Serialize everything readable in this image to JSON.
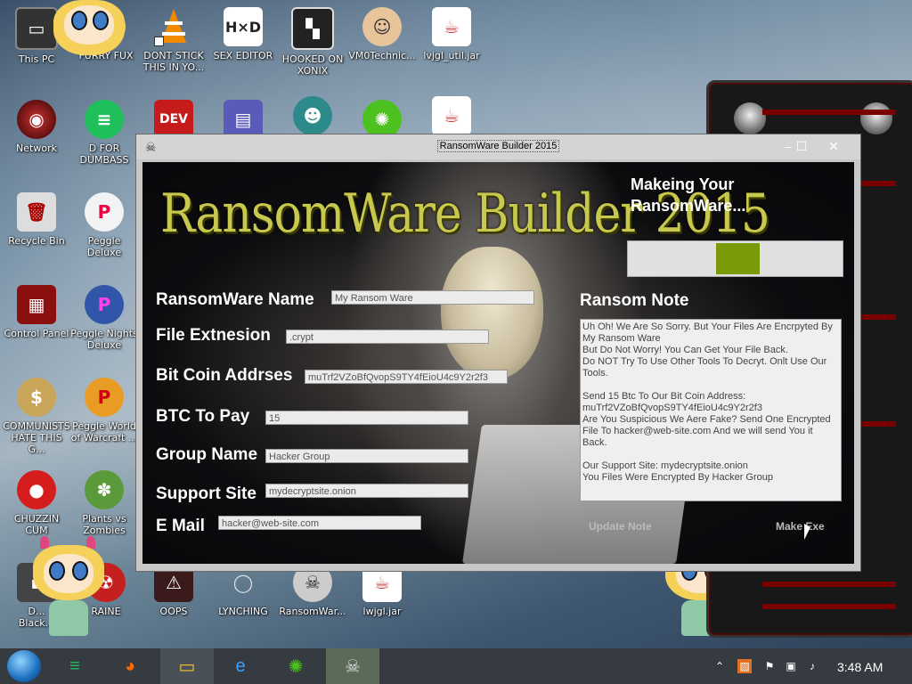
{
  "desktop": {
    "icons": [
      {
        "label": "This PC",
        "icon": "this-pc-icon"
      },
      {
        "label": "FURRY FUX",
        "icon": "furry-fux-icon"
      },
      {
        "label": "DONT STICK THIS IN YO...",
        "icon": "vlc-cone-icon"
      },
      {
        "label": "SEX EDITOR",
        "icon": "hxd-editor-icon"
      },
      {
        "label": "HOOKED ON XONIX",
        "icon": "xonix-game-icon"
      },
      {
        "label": "VM0Technic...",
        "icon": "doctor-icon"
      },
      {
        "label": "lvjgl_util.jar",
        "icon": "java-jar-icon"
      },
      {
        "label": "Network",
        "icon": "network-icon"
      },
      {
        "label": "D FOR DUMBASS",
        "icon": "d-app-icon"
      },
      {
        "label": "Recycle Bin",
        "icon": "recycle-bin-icon"
      },
      {
        "label": "Peggle Deluxe",
        "icon": "peggle-icon"
      },
      {
        "label": "Control Panel",
        "icon": "control-panel-icon"
      },
      {
        "label": "Peggle Nights Deluxe",
        "icon": "peggle-nights-icon"
      },
      {
        "label": "COMMUNISTS HATE THIS G...",
        "icon": "money-bag-icon"
      },
      {
        "label": "Peggle World of Warcraft ...",
        "icon": "peggle-wow-icon"
      },
      {
        "label": "CHUZZIN CUM",
        "icon": "chuzzle-icon"
      },
      {
        "label": "Plants vs Zombies",
        "icon": "plants-vs-zombies-icon"
      },
      {
        "label": "RAINE",
        "icon": "radiation-icon"
      },
      {
        "label": "OOPS",
        "icon": "oops-icon"
      },
      {
        "label": "LYNCHING",
        "icon": "rope-icon"
      },
      {
        "label": "RansomWar...",
        "icon": "skull-icon"
      },
      {
        "label": "lwjgl.jar",
        "icon": "java-jar-icon"
      },
      {
        "label": "D...",
        "icon": "d-partial-icon"
      },
      {
        "label": "Black...",
        "icon": "black-partial-icon"
      },
      {
        "label": "DEV C++",
        "icon": "devcpp-icon"
      }
    ]
  },
  "window": {
    "title": "RansomWare Builder 2015",
    "minimize_glyph": "‒",
    "maximize_glyph": "☐",
    "close_glyph": "✕",
    "banner": "RansomWare Builder 2015",
    "status_text": "Makeing Your RansomWare...",
    "progress_value": 0.2,
    "fields": {
      "name_label": "RansomWare Name",
      "name_value": "My Ransom Ware",
      "ext_label": "File Extnesion",
      "ext_value": ".crypt",
      "btc_label": "Bit Coin Addrses",
      "btc_value": "muTrf2VZoBfQvopS9TY4fEioU4c9Y2r2f3",
      "pay_label": "BTC To Pay",
      "pay_value": "15",
      "group_label": "Group Name",
      "group_value": "Hacker Group",
      "site_label": "Support Site",
      "site_value": "mydecryptsite.onion",
      "email_label": "E Mail",
      "email_value": "hacker@web-site.com"
    },
    "note_label": "Ransom Note",
    "note_text": "Uh Oh! We Are So Sorry. But Your Files Are Encrpyted By My Ransom Ware\nBut Do Not Worry! You Can Get Your File Back.\nDo NOT Try To Use Other Tools To Decryt. Onlt Use Our Tools.\n\nSend 15 Btc To Our Bit Coin Address:\nmuTrf2VZoBfQvopS9TY4fEioU4c9Y2r2f3\nAre You Suspicious We Aere Fake? Send One Encrypted File To hacker@web-site.com And we will send You it Back.\n\nOur Support Site: mydecryptsite.onion\nYou Files Were Encrypted By Hacker Group",
    "update_button": "Update Note",
    "make_button": "Make Exe"
  },
  "taskbar": {
    "clock": "3:48 AM",
    "apps": [
      "d-app-icon",
      "firefox-icon",
      "file-explorer-icon",
      "internet-explorer-icon",
      "limewire-icon",
      "ransomware-skull-icon"
    ]
  },
  "colors": {
    "banner_gold": "#c8c84e",
    "progress_green": "#7a9a0a",
    "taskbar": "#363b42"
  }
}
